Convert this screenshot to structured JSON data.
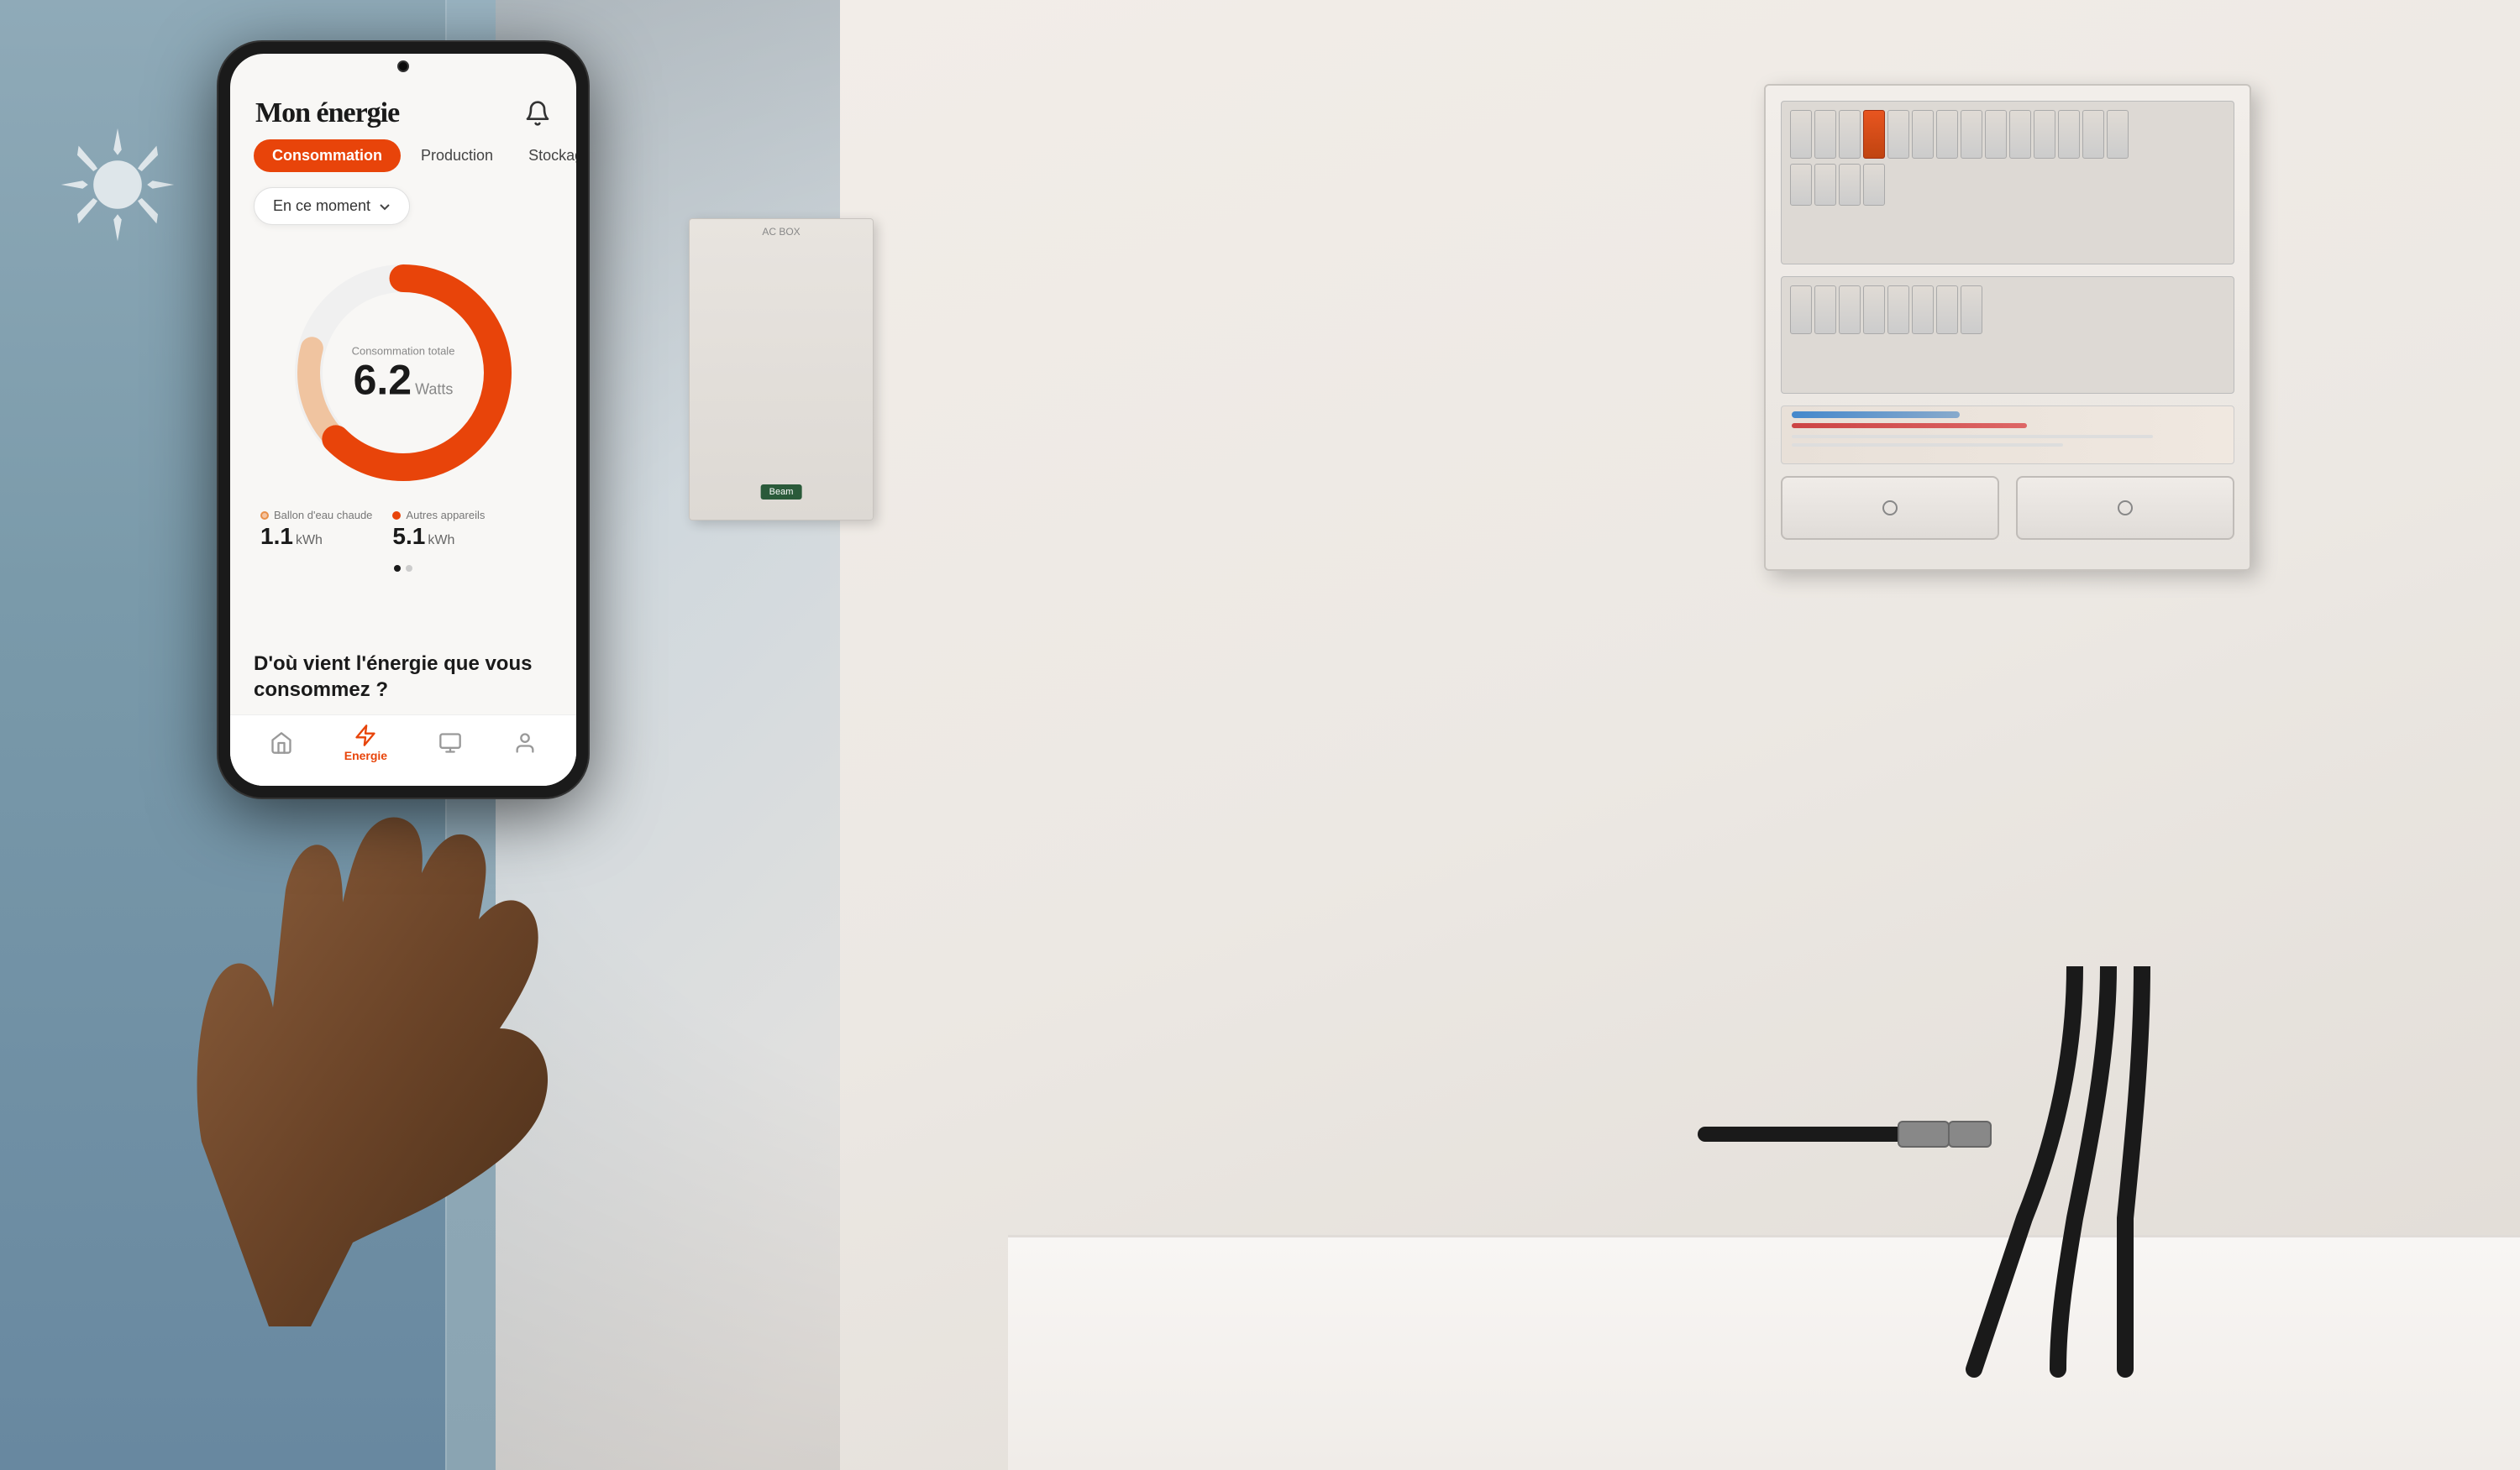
{
  "scene": {
    "background_color": "#d8d0c8"
  },
  "app": {
    "title": "Mon énergie",
    "notification_icon": "bell",
    "tabs": [
      {
        "id": "consommation",
        "label": "Consommation",
        "active": true
      },
      {
        "id": "production",
        "label": "Production",
        "active": false
      },
      {
        "id": "stockage",
        "label": "Stockage",
        "active": false
      }
    ],
    "dropdown": {
      "label": "En ce moment",
      "icon": "chevron-down"
    },
    "chart": {
      "label": "Consommation totale",
      "value": "6.2",
      "unit": "Watts",
      "segments": [
        {
          "id": "main",
          "color": "#e8440a",
          "percentage": 75,
          "stroke_dasharray": "235.6 314.2"
        },
        {
          "id": "secondary",
          "color": "#f0c0a0",
          "percentage": 20,
          "stroke_dasharray": "62.8 314.2",
          "offset": "-235.6"
        }
      ]
    },
    "stats": [
      {
        "id": "ballon",
        "label": "Ballon d'eau chaude",
        "value": "1.1",
        "unit": "kWh",
        "dot_color": "#f5b898",
        "dot_type": "light-orange"
      },
      {
        "id": "autres",
        "label": "Autres appareils",
        "value": "5.1",
        "unit": "kWh",
        "dot_color": "#e8440a",
        "dot_type": "dark-orange"
      }
    ],
    "pagination": {
      "total": 2,
      "active": 0
    },
    "bottom_question": "D'où vient l'énergie que vous consommez ?",
    "bottom_nav": [
      {
        "id": "home",
        "label": "",
        "icon": "home",
        "active": false
      },
      {
        "id": "energie",
        "label": "Energie",
        "icon": "lightning",
        "active": true
      },
      {
        "id": "devices",
        "label": "",
        "icon": "devices",
        "active": false
      },
      {
        "id": "profile",
        "label": "",
        "icon": "person",
        "active": false
      }
    ]
  },
  "ac_box": {
    "label": "AC BOX",
    "beam_label": "Beam"
  }
}
